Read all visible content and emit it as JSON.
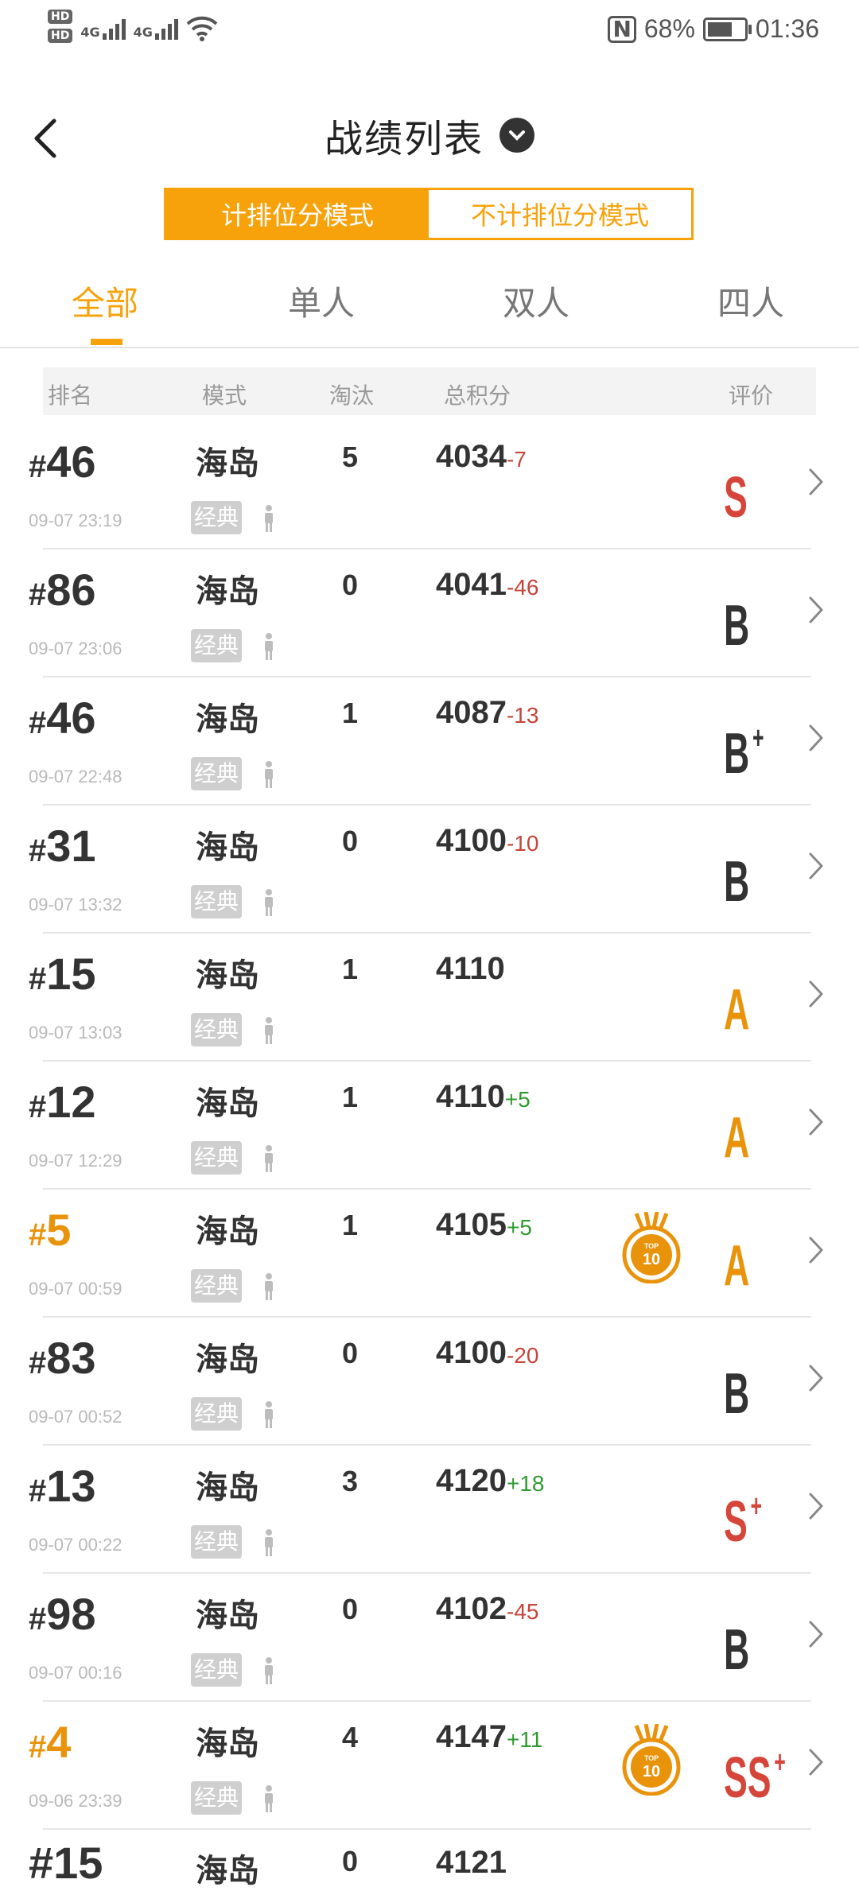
{
  "status": {
    "sim1": "HD",
    "sim2": "HD",
    "net1": "4G",
    "net2": "4G",
    "battery_percent": "68%",
    "battery_level": 0.68,
    "time": "01:36"
  },
  "header": {
    "title": "战绩列表"
  },
  "mode_toggle": {
    "ranked_label": "计排位分模式",
    "unranked_label": "不计排位分模式",
    "selected": "ranked"
  },
  "tabs": [
    {
      "label": "全部",
      "active": true
    },
    {
      "label": "单人",
      "active": false
    },
    {
      "label": "双人",
      "active": false
    },
    {
      "label": "四人",
      "active": false
    }
  ],
  "columns": {
    "rank": "排名",
    "mode": "模式",
    "kills": "淘汰",
    "score": "总积分",
    "rating": "评价"
  },
  "colors": {
    "accent": "#f7a20b",
    "negative": "#c5453a",
    "positive": "#2f9b2f",
    "grade_S": "#d6453a",
    "grade_A": "#e9930b",
    "grade_B": "#333333"
  },
  "matches": [
    {
      "hash": "#",
      "rank": "46",
      "date": "09-07 23:19",
      "map": "海岛",
      "tag": "经典",
      "kills": "5",
      "score": "4034",
      "delta": "-7",
      "delta_sign": "neg",
      "medal": false,
      "grade": "S",
      "grade_plus": "",
      "grade_color": "S"
    },
    {
      "hash": "#",
      "rank": "86",
      "date": "09-07 23:06",
      "map": "海岛",
      "tag": "经典",
      "kills": "0",
      "score": "4041",
      "delta": "-46",
      "delta_sign": "neg",
      "medal": false,
      "grade": "B",
      "grade_plus": "",
      "grade_color": "B"
    },
    {
      "hash": "#",
      "rank": "46",
      "date": "09-07 22:48",
      "map": "海岛",
      "tag": "经典",
      "kills": "1",
      "score": "4087",
      "delta": "-13",
      "delta_sign": "neg",
      "medal": false,
      "grade": "B",
      "grade_plus": "+",
      "grade_color": "B"
    },
    {
      "hash": "#",
      "rank": "31",
      "date": "09-07 13:32",
      "map": "海岛",
      "tag": "经典",
      "kills": "0",
      "score": "4100",
      "delta": "-10",
      "delta_sign": "neg",
      "medal": false,
      "grade": "B",
      "grade_plus": "",
      "grade_color": "B"
    },
    {
      "hash": "#",
      "rank": "15",
      "date": "09-07 13:03",
      "map": "海岛",
      "tag": "经典",
      "kills": "1",
      "score": "4110",
      "delta": "",
      "delta_sign": "",
      "medal": false,
      "grade": "A",
      "grade_plus": "",
      "grade_color": "A"
    },
    {
      "hash": "#",
      "rank": "12",
      "date": "09-07 12:29",
      "map": "海岛",
      "tag": "经典",
      "kills": "1",
      "score": "4110",
      "delta": "+5",
      "delta_sign": "pos",
      "medal": false,
      "grade": "A",
      "grade_plus": "",
      "grade_color": "A"
    },
    {
      "hash": "#",
      "rank": "5",
      "date": "09-07 00:59",
      "map": "海岛",
      "tag": "经典",
      "kills": "1",
      "score": "4105",
      "delta": "+5",
      "delta_sign": "pos",
      "medal": true,
      "medal_text": "TOP 10",
      "grade": "A",
      "grade_plus": "",
      "grade_color": "A"
    },
    {
      "hash": "#",
      "rank": "83",
      "date": "09-07 00:52",
      "map": "海岛",
      "tag": "经典",
      "kills": "0",
      "score": "4100",
      "delta": "-20",
      "delta_sign": "neg",
      "medal": false,
      "grade": "B",
      "grade_plus": "",
      "grade_color": "B"
    },
    {
      "hash": "#",
      "rank": "13",
      "date": "09-07 00:22",
      "map": "海岛",
      "tag": "经典",
      "kills": "3",
      "score": "4120",
      "delta": "+18",
      "delta_sign": "pos",
      "medal": false,
      "grade": "S",
      "grade_plus": "+",
      "grade_color": "S"
    },
    {
      "hash": "#",
      "rank": "98",
      "date": "09-07 00:16",
      "map": "海岛",
      "tag": "经典",
      "kills": "0",
      "score": "4102",
      "delta": "-45",
      "delta_sign": "neg",
      "medal": false,
      "grade": "B",
      "grade_plus": "",
      "grade_color": "B"
    },
    {
      "hash": "#",
      "rank": "4",
      "date": "09-06 23:39",
      "map": "海岛",
      "tag": "经典",
      "kills": "4",
      "score": "4147",
      "delta": "+11",
      "delta_sign": "pos",
      "medal": true,
      "medal_text": "TOP 10",
      "grade": "SS",
      "grade_plus": "+",
      "grade_color": "S"
    }
  ],
  "partial_row": {
    "rank": "#15",
    "map": "海岛",
    "kills": "0",
    "score": "4121"
  }
}
